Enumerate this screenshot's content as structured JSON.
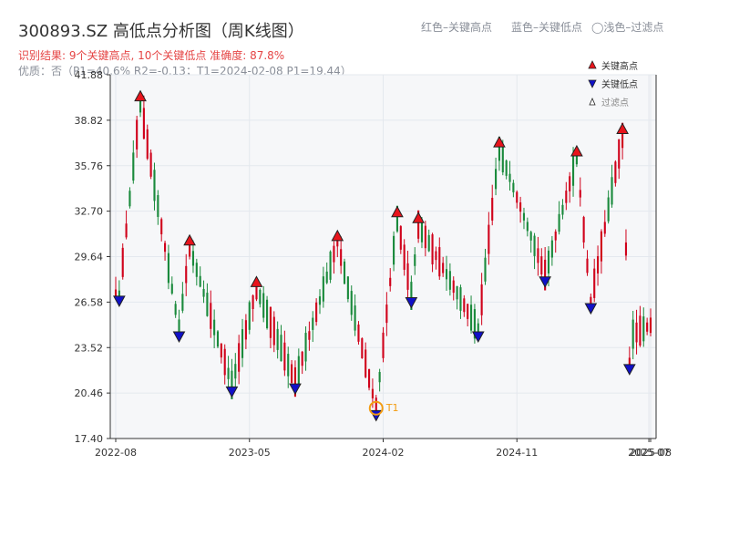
{
  "header": {
    "title": "300893.SZ 高低点分析图（周K线图）",
    "hint_red": "红色–关键高点",
    "hint_blue": "蓝色–关键低点",
    "hint_light": "◯浅色–过滤点",
    "result": "识别结果: 9个关键高点, 10个关键低点   准确度: 87.8%",
    "quality": "优质：否（P1=40.6%  R2=-0.13；T1=2024-02-08 P1=19.44）"
  },
  "colors": {
    "up": "#d0021b",
    "down": "#1a8a3c",
    "high": "#e8141c",
    "low": "#1010c8",
    "t1": "#f39c12",
    "grid": "#e4e8ee",
    "plotbg": "#f6f7f9"
  },
  "chart_data": {
    "type": "candlestick",
    "ylim": [
      17.4,
      41.88
    ],
    "yticks": [
      17.4,
      20.46,
      23.52,
      26.58,
      29.64,
      32.7,
      35.76,
      38.82,
      41.88
    ],
    "xlim": [
      0,
      152
    ],
    "xticks": [
      {
        "pos": 0,
        "label": "2022-08"
      },
      {
        "pos": 38,
        "label": "2023-05"
      },
      {
        "pos": 76,
        "label": "2024-02"
      },
      {
        "pos": 114,
        "label": "2024-11"
      },
      {
        "pos": 151.5,
        "label": "2025-07"
      },
      {
        "pos": 152,
        "label": "2025-08"
      }
    ],
    "legend": [
      {
        "label": "关键高点",
        "marker": "red-up-triangle"
      },
      {
        "label": "关键低点",
        "marker": "blue-down-triangle"
      },
      {
        "label": "过滤点",
        "marker": "hollow-up-triangle"
      }
    ],
    "high_points": [
      {
        "idx": 7,
        "value": 40.0
      },
      {
        "idx": 21,
        "value": 30.3
      },
      {
        "idx": 40,
        "value": 27.5
      },
      {
        "idx": 63,
        "value": 30.6
      },
      {
        "idx": 80,
        "value": 32.2
      },
      {
        "idx": 86,
        "value": 31.8
      },
      {
        "idx": 109,
        "value": 36.9
      },
      {
        "idx": 131,
        "value": 36.3
      },
      {
        "idx": 144,
        "value": 37.8
      }
    ],
    "low_points": [
      {
        "idx": 1,
        "value": 27.1
      },
      {
        "idx": 18,
        "value": 24.7
      },
      {
        "idx": 33,
        "value": 21.0
      },
      {
        "idx": 51,
        "value": 21.2
      },
      {
        "idx": 74,
        "value": 19.4
      },
      {
        "idx": 84,
        "value": 27.0
      },
      {
        "idx": 103,
        "value": 24.7
      },
      {
        "idx": 122,
        "value": 28.4
      },
      {
        "idx": 135,
        "value": 26.6
      },
      {
        "idx": 146,
        "value": 22.5
      }
    ],
    "t1": {
      "idx": 74,
      "value": 19.44,
      "label": "T1"
    }
  }
}
